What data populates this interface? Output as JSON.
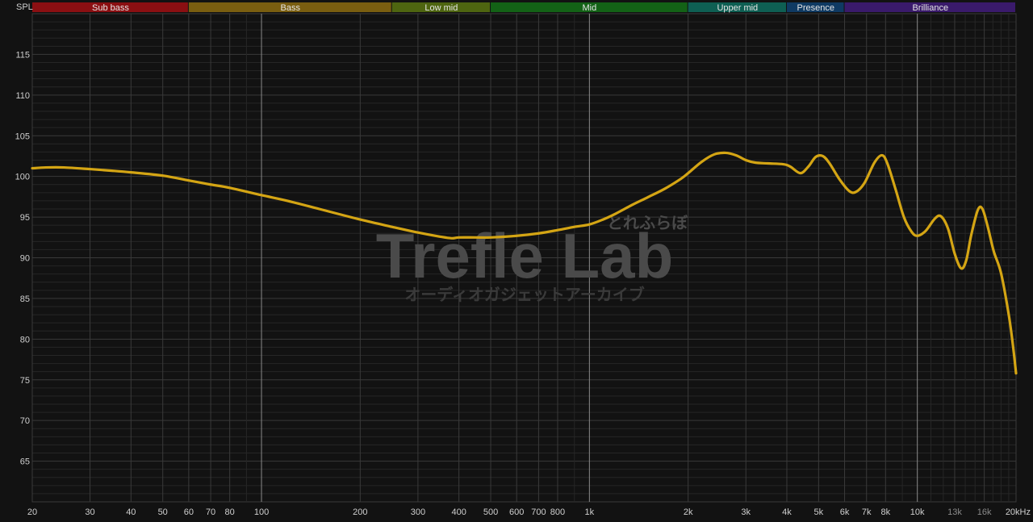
{
  "colors": {
    "background": "#121212",
    "curve": "#d4a514",
    "grid_major": "#3a3a3a",
    "grid_minor": "#262626",
    "grid_decade": "#8a8a8a"
  },
  "watermark": {
    "main": "Trefle Lab",
    "kana": "とれふらぼ",
    "sub": "オーディオガジェットアーカイブ"
  },
  "chart_data": {
    "type": "line",
    "title": "",
    "ylabel": "SPL",
    "xlabel": "",
    "x_scale": "log",
    "xlim": [
      20,
      20000
    ],
    "ylim": [
      60,
      120
    ],
    "grid": true,
    "y_ticks": [
      65,
      70,
      75,
      80,
      85,
      90,
      95,
      100,
      105,
      110,
      115
    ],
    "x_ticks": [
      {
        "value": 20,
        "label": "20"
      },
      {
        "value": 30,
        "label": "30"
      },
      {
        "value": 40,
        "label": "40"
      },
      {
        "value": 50,
        "label": "50"
      },
      {
        "value": 60,
        "label": "60"
      },
      {
        "value": 70,
        "label": "70"
      },
      {
        "value": 80,
        "label": "80"
      },
      {
        "value": 100,
        "label": "100"
      },
      {
        "value": 200,
        "label": "200"
      },
      {
        "value": 300,
        "label": "300"
      },
      {
        "value": 400,
        "label": "400"
      },
      {
        "value": 500,
        "label": "500"
      },
      {
        "value": 600,
        "label": "600"
      },
      {
        "value": 700,
        "label": "700"
      },
      {
        "value": 800,
        "label": "800"
      },
      {
        "value": 1000,
        "label": "1k"
      },
      {
        "value": 2000,
        "label": "2k"
      },
      {
        "value": 3000,
        "label": "3k"
      },
      {
        "value": 4000,
        "label": "4k"
      },
      {
        "value": 5000,
        "label": "5k"
      },
      {
        "value": 6000,
        "label": "6k"
      },
      {
        "value": 7000,
        "label": "7k"
      },
      {
        "value": 8000,
        "label": "8k"
      },
      {
        "value": 10000,
        "label": "10k"
      },
      {
        "value": 13000,
        "label": "13k",
        "dim": true
      },
      {
        "value": 16000,
        "label": "16k",
        "dim": true
      },
      {
        "value": 20000,
        "label": "20kHz"
      }
    ],
    "bands": [
      {
        "name": "Sub bass",
        "from": 20,
        "to": 60,
        "color": "#8b0f12"
      },
      {
        "name": "Bass",
        "from": 60,
        "to": 250,
        "color": "#7a5e10"
      },
      {
        "name": "Low mid",
        "from": 250,
        "to": 500,
        "color": "#4e6510"
      },
      {
        "name": "Mid",
        "from": 500,
        "to": 2000,
        "color": "#136216"
      },
      {
        "name": "Upper mid",
        "from": 2000,
        "to": 4000,
        "color": "#0e5f53"
      },
      {
        "name": "Presence",
        "from": 4000,
        "to": 6000,
        "color": "#0f3a63"
      },
      {
        "name": "Brilliance",
        "from": 6000,
        "to": 20000,
        "color": "#3a1a6b"
      }
    ],
    "series": [
      {
        "name": "",
        "points": [
          [
            20,
            101
          ],
          [
            22,
            101.1
          ],
          [
            25,
            101.1
          ],
          [
            30,
            100.9
          ],
          [
            35,
            100.7
          ],
          [
            40,
            100.5
          ],
          [
            50,
            100.1
          ],
          [
            60,
            99.5
          ],
          [
            70,
            99.0
          ],
          [
            80,
            98.6
          ],
          [
            100,
            97.7
          ],
          [
            120,
            97.0
          ],
          [
            150,
            96.0
          ],
          [
            200,
            94.7
          ],
          [
            250,
            93.8
          ],
          [
            300,
            93.1
          ],
          [
            350,
            92.6
          ],
          [
            380,
            92.4
          ],
          [
            400,
            92.5
          ],
          [
            450,
            92.5
          ],
          [
            500,
            92.5
          ],
          [
            600,
            92.7
          ],
          [
            700,
            93.0
          ],
          [
            800,
            93.4
          ],
          [
            900,
            93.8
          ],
          [
            1000,
            94.1
          ],
          [
            1100,
            94.7
          ],
          [
            1200,
            95.4
          ],
          [
            1350,
            96.5
          ],
          [
            1500,
            97.4
          ],
          [
            1700,
            98.5
          ],
          [
            1900,
            99.7
          ],
          [
            2000,
            100.4
          ],
          [
            2200,
            101.8
          ],
          [
            2400,
            102.7
          ],
          [
            2600,
            102.9
          ],
          [
            2800,
            102.6
          ],
          [
            3000,
            102.0
          ],
          [
            3200,
            101.7
          ],
          [
            3500,
            101.6
          ],
          [
            3900,
            101.5
          ],
          [
            4100,
            101.2
          ],
          [
            4400,
            100.4
          ],
          [
            4650,
            101.2
          ],
          [
            4900,
            102.4
          ],
          [
            5150,
            102.5
          ],
          [
            5400,
            101.6
          ],
          [
            5800,
            99.6
          ],
          [
            6200,
            98.2
          ],
          [
            6500,
            98.1
          ],
          [
            6900,
            99.2
          ],
          [
            7400,
            101.7
          ],
          [
            7800,
            102.6
          ],
          [
            8100,
            101.6
          ],
          [
            8600,
            98.3
          ],
          [
            9100,
            95.0
          ],
          [
            9600,
            93.2
          ],
          [
            10000,
            92.7
          ],
          [
            10600,
            93.3
          ],
          [
            11300,
            94.8
          ],
          [
            11800,
            95.1
          ],
          [
            12400,
            93.6
          ],
          [
            13000,
            90.5
          ],
          [
            13600,
            88.7
          ],
          [
            14100,
            89.7
          ],
          [
            14600,
            92.8
          ],
          [
            15300,
            95.9
          ],
          [
            15800,
            96.0
          ],
          [
            16400,
            93.8
          ],
          [
            17100,
            90.8
          ],
          [
            18000,
            88.1
          ],
          [
            19000,
            83.0
          ],
          [
            19600,
            79.0
          ],
          [
            20000,
            75.8
          ]
        ]
      }
    ]
  }
}
